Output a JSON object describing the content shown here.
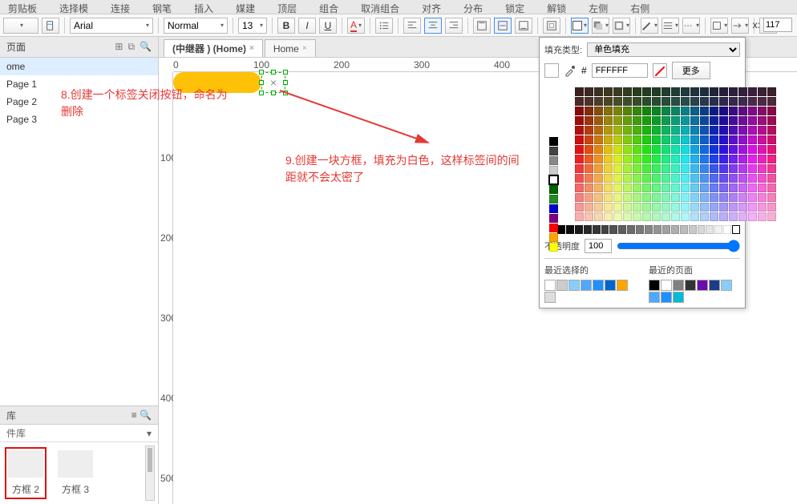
{
  "menubar": [
    "剪贴板",
    "选择模",
    "连接",
    "钢笔",
    "",
    "插入",
    "媒建",
    "顶层",
    "",
    "组合",
    "取消组合",
    "对齐",
    "分布",
    "锁定",
    "解锁",
    "左侧",
    "右侧"
  ],
  "toolbar": {
    "font": "Arial",
    "paragraph": "Normal",
    "fontsize": "13",
    "x_label": "x:",
    "x_value": "117"
  },
  "pages_panel": {
    "title": "页面",
    "home": "ome",
    "items": [
      "Page 1",
      "Page 2",
      "Page 3"
    ]
  },
  "lib_panel": {
    "title": "库",
    "sub": "件库",
    "items": [
      {
        "label": "方框 2",
        "selected": true
      },
      {
        "label": "方框 3",
        "selected": false
      }
    ]
  },
  "tabs": [
    {
      "label": "(中继器 ) (Home)",
      "active": true
    },
    {
      "label": "Home",
      "active": false
    }
  ],
  "ruler_h": [
    "0",
    "100",
    "200",
    "300",
    "400"
  ],
  "ruler_v": [
    "100",
    "200",
    "300",
    "400",
    "500"
  ],
  "annotations": {
    "a8": "8.创建一个标签关闭按钮，命名为删除",
    "a9": "9.创建一块方框，填充为白色，这样标签间的间距就不会太密了"
  },
  "colorpanel": {
    "fill_type_label": "填充类型:",
    "fill_type_value": "单色填充",
    "hex_prefix": "#",
    "hex_value": "FFFFFF",
    "more": "更多",
    "opacity_label": "不透明度",
    "opacity_value": "100",
    "recent_selected_label": "最近选择的",
    "recent_page_label": "最近的页面",
    "sidebar_colors": [
      "#000000",
      "#444444",
      "#888888",
      "#cccccc",
      "#ffffff",
      "#006400",
      "#228B22",
      "#0000cd",
      "#800080",
      "#ff0000",
      "#ffa500",
      "#ffff00"
    ],
    "recent_selected": [
      "#ffffff",
      "#cccccc",
      "#87cefa",
      "#4fa8ff",
      "#1e90ff",
      "#0066cc",
      "#ffa500",
      "#dddddd"
    ],
    "recent_page": [
      "#000000",
      "#ffffff",
      "#808080",
      "#333333",
      "#6a0dad",
      "#1e3a8a",
      "#87cefa",
      "#4fa8ff",
      "#1e90ff",
      "#00bcd4"
    ]
  }
}
